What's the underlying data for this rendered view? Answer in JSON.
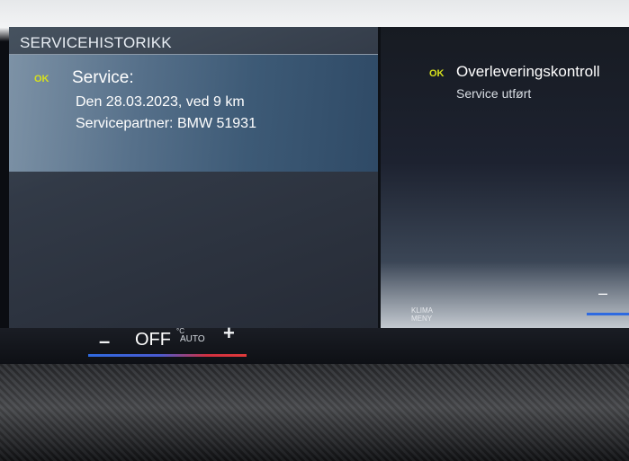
{
  "screen": {
    "title": "SERVICEHISTORIKK"
  },
  "service_entry": {
    "status": "OK",
    "title": "Service:",
    "date_line": "Den 28.03.2023, ved 9 km",
    "partner_line": "Servicepartner: BMW 51931"
  },
  "detail": {
    "status": "OK",
    "title": "Overleveringskontroll",
    "subtitle": "Service utført"
  },
  "climate": {
    "minus_label": "–",
    "off_label": "OFF",
    "unit_label": "°C",
    "auto_label": "AUTO",
    "plus_label": "+",
    "menu_line1": "KLIMA",
    "menu_line2": "MENY",
    "right_minus_label": "–"
  },
  "colors": {
    "ok_badge": "#d6e01d",
    "cold": "#2f6ae0",
    "warm": "#e03a3a"
  }
}
